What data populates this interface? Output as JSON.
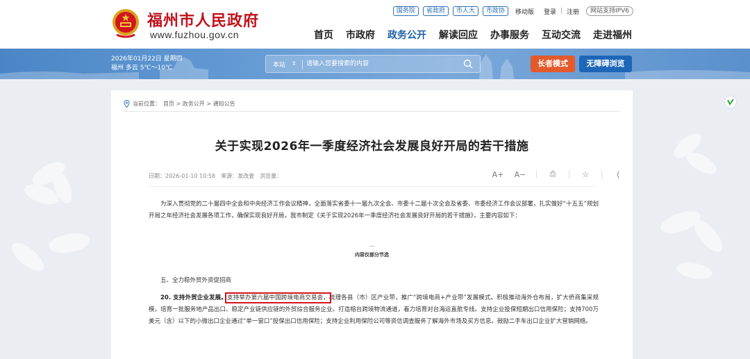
{
  "header": {
    "site_name": "福州市人民政府",
    "site_url": "www.fuzhou.gov.cn",
    "top_links": [
      "国务院",
      "省政府",
      "市人大",
      "市政协"
    ],
    "mobile": "移动版",
    "login": "登录",
    "register": "注册",
    "ipv6": "网站支持IPV6",
    "nav": [
      "首页",
      "市政府",
      "政务公开",
      "解读回应",
      "办事服务",
      "互动交流",
      "走进福州"
    ],
    "active_nav": "政务公开"
  },
  "banner": {
    "date": "2026年01月22日 星期四",
    "weather": "福州 多云 5℃～10℃",
    "search_scope": "本站",
    "search_placeholder": "请输入您要搜索的内容",
    "elder_mode": "长者模式",
    "accessible": "无障碍浏览"
  },
  "article": {
    "breadcrumb_label": "当前位置：",
    "breadcrumb": "首页 > 政务公开 > 通知公告",
    "title": "关于实现2026年一季度经济社会发展良好开局的若干措施",
    "date": "日期：2026-01-10 10:58",
    "source": "来源：发改委",
    "views": "浏览量：",
    "tools": [
      "A+",
      "A−",
      "⎙",
      "☆",
      "⟨"
    ],
    "intro": "为深入贯彻党的二十届四中全会和中央经济工作会议精神，全面落实省委十一届九次全会、市委十二届十次全会及省委、市委经济工作会议部署，扎实做好“十五五”规划开局之年经济社会发展各项工作，确保实现良好开局，我市制定《关于实现2026年一季度经济社会发展良好开局的若干措施》，主要内容如下：",
    "ellipsis": "…",
    "excerpt_note": "内容仅部分节选",
    "section_title": "五、全力稳外贸外资促招商",
    "item_heading": "20. 支持外贸企业发展。",
    "item_highlight": "支持举办第六届中国跨境电商交易会，",
    "item_body": "梳理各县（市）区产业带，推广“跨境电商+产业带”发展模式。积极推动海外仓布局，扩大侨商集采规模，培育一批服务地产品出口、稳定产业链供应链的外贸综合服务企业。打造榕台跨境物流通道，着力培育对台海运直航专线。支持企业投保短期出口信用保险；支持700万美元（含）以下的小微出口企业通过“单一窗口”投保出口信用保险；支持企业利用保险公司等资信调查服务了解海外市场及买方信息。鼓励二手车出口企业扩大营销网络。"
  },
  "colors": {
    "brand_red": "#c0121c",
    "nav_blue": "#1d5fa8",
    "elder_orange": "#e35a2c",
    "access_blue": "#1d66b8",
    "highlight_border": "#d4141c"
  }
}
